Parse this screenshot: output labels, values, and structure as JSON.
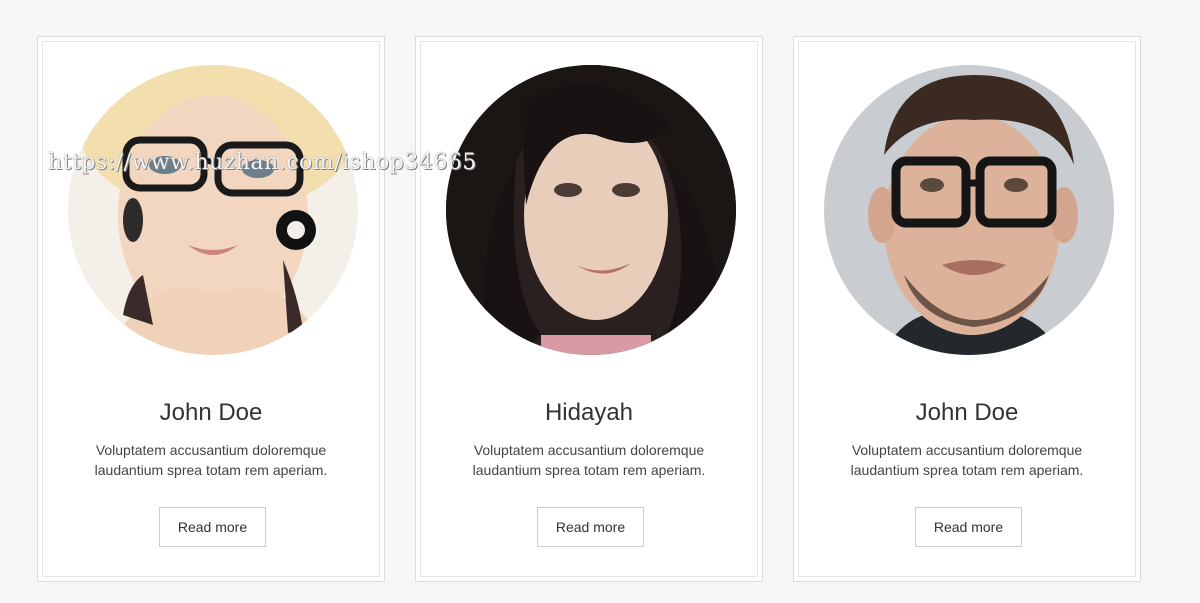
{
  "cards": [
    {
      "name": "John Doe",
      "description": "Voluptatem accusantium doloremque laudantium sprea totam rem aperiam.",
      "button_label": "Read more"
    },
    {
      "name": "Hidayah",
      "description": "Voluptatem accusantium doloremque laudantium sprea totam rem aperiam.",
      "button_label": "Read more"
    },
    {
      "name": "John Doe",
      "description": "Voluptatem accusantium doloremque laudantium sprea totam rem aperiam.",
      "button_label": "Read more"
    }
  ],
  "watermark": "https://www.huzhan.com/ishop34665"
}
